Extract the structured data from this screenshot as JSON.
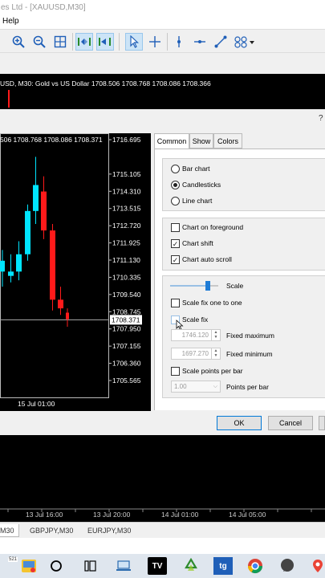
{
  "window": {
    "title": "es Ltd - [XAUUSD,M30]"
  },
  "menu": {
    "help": "Help"
  },
  "toolbar_icons": [
    "zoom-in-icon",
    "zoom-out-icon",
    "grid-icon",
    "autoscroll-icon",
    "chart-shift-icon",
    "cursor-icon",
    "crosshair-icon",
    "vertical-line-icon",
    "horizontal-line-icon",
    "trendline-icon",
    "shapes-icon"
  ],
  "chart_header": {
    "info": "USD, M30:  Gold vs US Dollar  1708.506 1708.768 1708.086 1708.366"
  },
  "preview": {
    "header": "506 1708.768 1708.086 1708.371",
    "price_labels": [
      "1716.695",
      "1715.105",
      "1714.310",
      "1713.515",
      "1712.720",
      "1711.925",
      "1711.130",
      "1710.335",
      "1709.540",
      "1708.745",
      "1707.950",
      "1707.155",
      "1706.360",
      "1705.565"
    ],
    "current_price": "1708.371",
    "time_label": "15 Jul 01:00"
  },
  "dialog": {
    "help": "?",
    "tabs": [
      "Common",
      "Show",
      "Colors"
    ],
    "chart_type": {
      "bar": "Bar chart",
      "candles": "Candlesticks",
      "line": "Line chart",
      "selected": "Candlesticks"
    },
    "flags": {
      "foreground": {
        "label": "Chart on foreground",
        "checked": false
      },
      "shift": {
        "label": "Chart shift",
        "checked": true
      },
      "autoscroll": {
        "label": "Chart auto scroll",
        "checked": true
      }
    },
    "scale": {
      "label": "Scale",
      "slider_fraction": 0.78,
      "one_to_one": "Scale fix one to one",
      "fix": "Scale fix",
      "fixed_max_label": "Fixed maximum",
      "fixed_max_value": "1746.120",
      "fixed_min_label": "Fixed minimum",
      "fixed_min_value": "1697.270",
      "points_per_bar_label": "Scale points per bar",
      "points_per_bar_caption": "Points per bar",
      "points_per_bar_value": "1.00"
    },
    "buttons": {
      "ok": "OK",
      "cancel": "Cancel"
    }
  },
  "bottom_chart": {
    "time_labels": [
      "13 Jul 16:00",
      "13 Jul 20:00",
      "14 Jul 01:00",
      "14 Jul 05:00"
    ]
  },
  "chart_tabs": [
    "M30",
    "GBPJPY,M30",
    "EURJPY,M30"
  ],
  "taskbar": {
    "badge": "521",
    "icons": [
      "app-icon",
      "circle-icon",
      "task-view-icon",
      "laptop-icon",
      "tradingview-icon",
      "recycle-icon",
      "tg-icon",
      "chrome-icon",
      "chat-icon",
      "maps-icon"
    ],
    "tv_text": "TV",
    "tg_text": "tg"
  },
  "colors": {
    "bull": "#00e5ff",
    "bear": "#ff1a1a",
    "chart_bg": "#000000",
    "accent": "#1e7cd6"
  }
}
